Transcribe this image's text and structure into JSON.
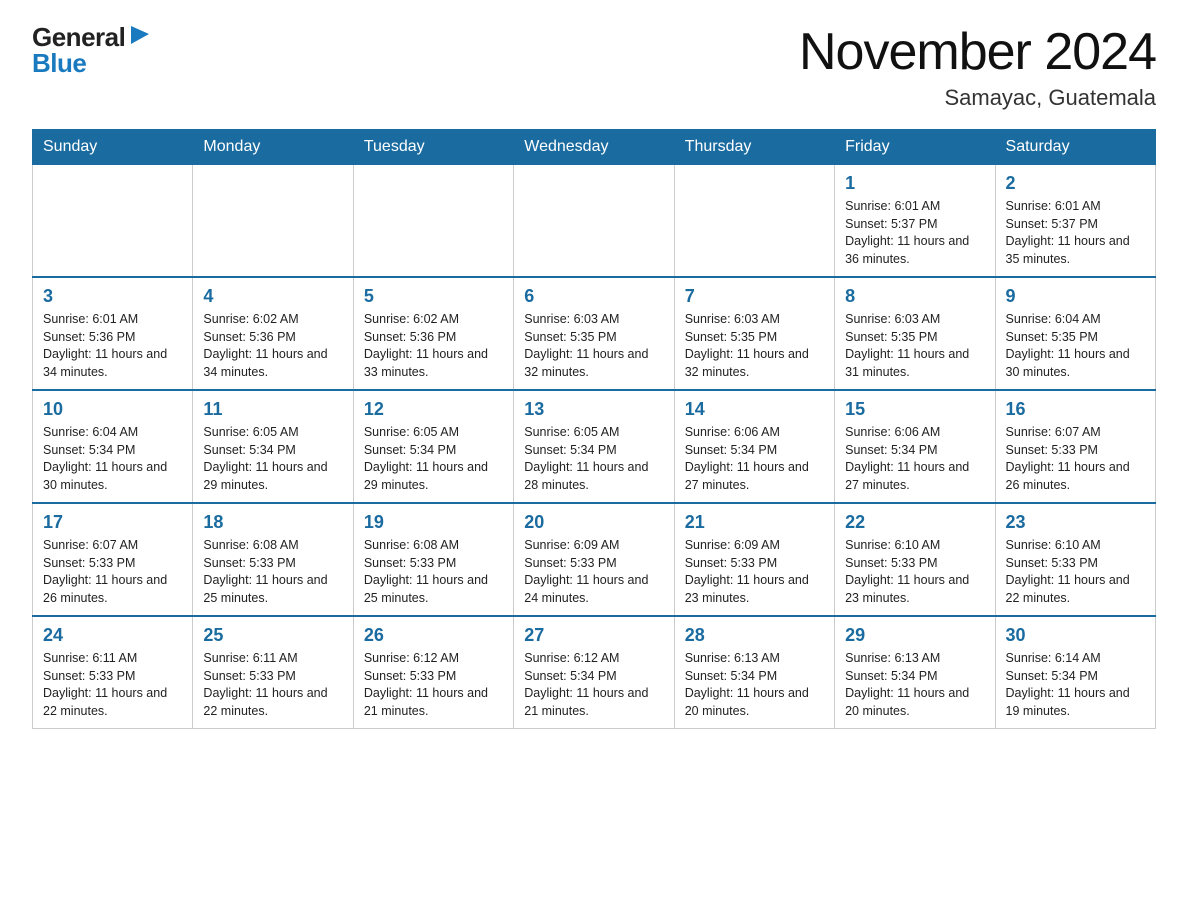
{
  "logo": {
    "general": "General",
    "blue": "Blue",
    "triangle": "▶"
  },
  "header": {
    "month_year": "November 2024",
    "location": "Samayac, Guatemala"
  },
  "weekdays": [
    "Sunday",
    "Monday",
    "Tuesday",
    "Wednesday",
    "Thursday",
    "Friday",
    "Saturday"
  ],
  "weeks": [
    [
      {
        "day": "",
        "info": ""
      },
      {
        "day": "",
        "info": ""
      },
      {
        "day": "",
        "info": ""
      },
      {
        "day": "",
        "info": ""
      },
      {
        "day": "",
        "info": ""
      },
      {
        "day": "1",
        "info": "Sunrise: 6:01 AM\nSunset: 5:37 PM\nDaylight: 11 hours and 36 minutes."
      },
      {
        "day": "2",
        "info": "Sunrise: 6:01 AM\nSunset: 5:37 PM\nDaylight: 11 hours and 35 minutes."
      }
    ],
    [
      {
        "day": "3",
        "info": "Sunrise: 6:01 AM\nSunset: 5:36 PM\nDaylight: 11 hours and 34 minutes."
      },
      {
        "day": "4",
        "info": "Sunrise: 6:02 AM\nSunset: 5:36 PM\nDaylight: 11 hours and 34 minutes."
      },
      {
        "day": "5",
        "info": "Sunrise: 6:02 AM\nSunset: 5:36 PM\nDaylight: 11 hours and 33 minutes."
      },
      {
        "day": "6",
        "info": "Sunrise: 6:03 AM\nSunset: 5:35 PM\nDaylight: 11 hours and 32 minutes."
      },
      {
        "day": "7",
        "info": "Sunrise: 6:03 AM\nSunset: 5:35 PM\nDaylight: 11 hours and 32 minutes."
      },
      {
        "day": "8",
        "info": "Sunrise: 6:03 AM\nSunset: 5:35 PM\nDaylight: 11 hours and 31 minutes."
      },
      {
        "day": "9",
        "info": "Sunrise: 6:04 AM\nSunset: 5:35 PM\nDaylight: 11 hours and 30 minutes."
      }
    ],
    [
      {
        "day": "10",
        "info": "Sunrise: 6:04 AM\nSunset: 5:34 PM\nDaylight: 11 hours and 30 minutes."
      },
      {
        "day": "11",
        "info": "Sunrise: 6:05 AM\nSunset: 5:34 PM\nDaylight: 11 hours and 29 minutes."
      },
      {
        "day": "12",
        "info": "Sunrise: 6:05 AM\nSunset: 5:34 PM\nDaylight: 11 hours and 29 minutes."
      },
      {
        "day": "13",
        "info": "Sunrise: 6:05 AM\nSunset: 5:34 PM\nDaylight: 11 hours and 28 minutes."
      },
      {
        "day": "14",
        "info": "Sunrise: 6:06 AM\nSunset: 5:34 PM\nDaylight: 11 hours and 27 minutes."
      },
      {
        "day": "15",
        "info": "Sunrise: 6:06 AM\nSunset: 5:34 PM\nDaylight: 11 hours and 27 minutes."
      },
      {
        "day": "16",
        "info": "Sunrise: 6:07 AM\nSunset: 5:33 PM\nDaylight: 11 hours and 26 minutes."
      }
    ],
    [
      {
        "day": "17",
        "info": "Sunrise: 6:07 AM\nSunset: 5:33 PM\nDaylight: 11 hours and 26 minutes."
      },
      {
        "day": "18",
        "info": "Sunrise: 6:08 AM\nSunset: 5:33 PM\nDaylight: 11 hours and 25 minutes."
      },
      {
        "day": "19",
        "info": "Sunrise: 6:08 AM\nSunset: 5:33 PM\nDaylight: 11 hours and 25 minutes."
      },
      {
        "day": "20",
        "info": "Sunrise: 6:09 AM\nSunset: 5:33 PM\nDaylight: 11 hours and 24 minutes."
      },
      {
        "day": "21",
        "info": "Sunrise: 6:09 AM\nSunset: 5:33 PM\nDaylight: 11 hours and 23 minutes."
      },
      {
        "day": "22",
        "info": "Sunrise: 6:10 AM\nSunset: 5:33 PM\nDaylight: 11 hours and 23 minutes."
      },
      {
        "day": "23",
        "info": "Sunrise: 6:10 AM\nSunset: 5:33 PM\nDaylight: 11 hours and 22 minutes."
      }
    ],
    [
      {
        "day": "24",
        "info": "Sunrise: 6:11 AM\nSunset: 5:33 PM\nDaylight: 11 hours and 22 minutes."
      },
      {
        "day": "25",
        "info": "Sunrise: 6:11 AM\nSunset: 5:33 PM\nDaylight: 11 hours and 22 minutes."
      },
      {
        "day": "26",
        "info": "Sunrise: 6:12 AM\nSunset: 5:33 PM\nDaylight: 11 hours and 21 minutes."
      },
      {
        "day": "27",
        "info": "Sunrise: 6:12 AM\nSunset: 5:34 PM\nDaylight: 11 hours and 21 minutes."
      },
      {
        "day": "28",
        "info": "Sunrise: 6:13 AM\nSunset: 5:34 PM\nDaylight: 11 hours and 20 minutes."
      },
      {
        "day": "29",
        "info": "Sunrise: 6:13 AM\nSunset: 5:34 PM\nDaylight: 11 hours and 20 minutes."
      },
      {
        "day": "30",
        "info": "Sunrise: 6:14 AM\nSunset: 5:34 PM\nDaylight: 11 hours and 19 minutes."
      }
    ]
  ]
}
